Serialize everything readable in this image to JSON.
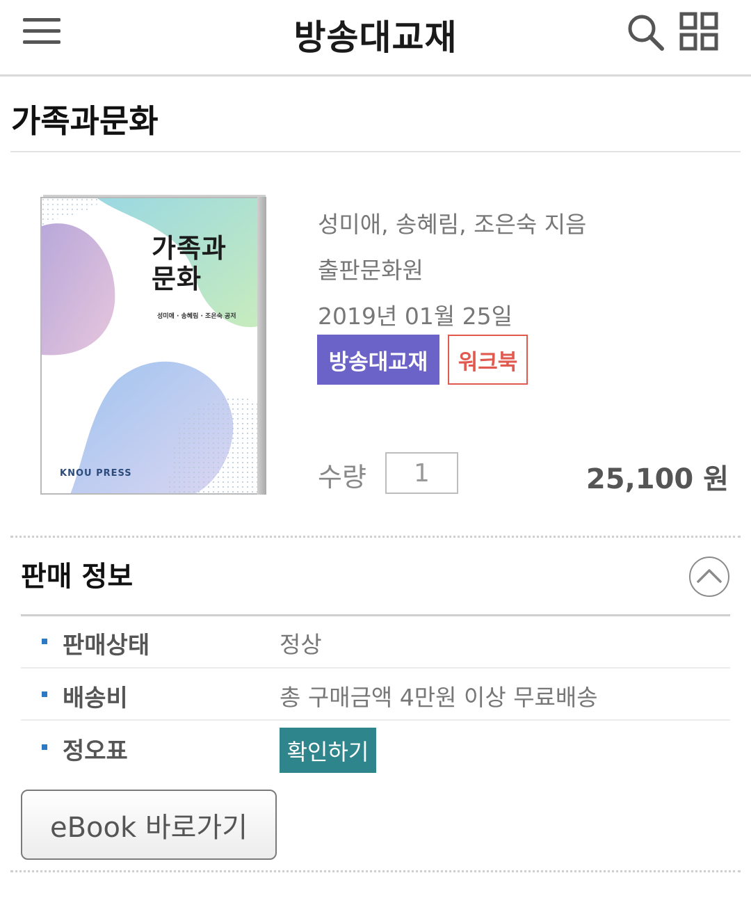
{
  "header": {
    "title": "방송대교재",
    "menu_icon": "menu-icon",
    "search_icon": "search-icon",
    "grid_icon": "grid-icon"
  },
  "book": {
    "title": "가족과문화",
    "cover_title_line1": "가족과",
    "cover_title_line2": "문화",
    "cover_authors": "성미애 · 송혜림 · 조은숙 공저",
    "cover_publisher": "KNOU PRESS",
    "authors": "성미애, 송혜림, 조은숙 지음",
    "publisher": "출판문화원",
    "pub_date": "2019년 01월 25일",
    "badges": [
      "방송대교재",
      "워크북"
    ],
    "quantity_label": "수량",
    "quantity_value": "1",
    "price": "25,100 원"
  },
  "sales_info": {
    "title": "판매 정보",
    "rows": [
      {
        "label": "판매상태",
        "value": "정상"
      },
      {
        "label": "배송비",
        "value": "총 구매금액 4만원 이상 무료배송"
      },
      {
        "label": "정오표",
        "button": "확인하기"
      }
    ],
    "ebook_button": "eBook 바로가기"
  },
  "colors": {
    "badge_primary": "#6b63c7",
    "badge_secondary": "#e05a50",
    "confirm_button": "#2f858c",
    "bullet": "#2e78c6"
  }
}
